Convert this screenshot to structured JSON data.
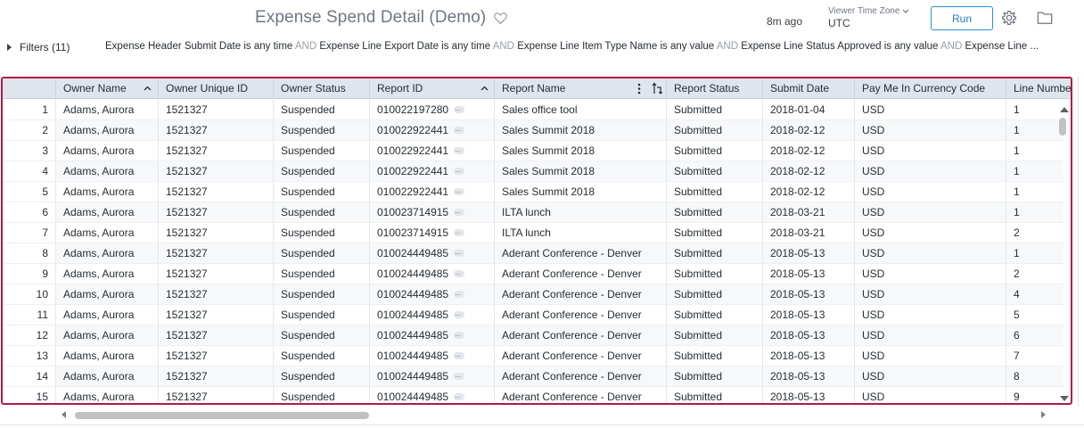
{
  "header": {
    "title": "Expense Spend Detail (Demo)",
    "updated_ago": "8m ago",
    "timezone_label": "Viewer Time Zone",
    "timezone_value": "UTC",
    "run_label": "Run",
    "icons": [
      "heart-icon",
      "chevron-down-icon",
      "gear-icon",
      "folder-icon"
    ]
  },
  "filters": {
    "label": "Filters (11)",
    "clauses": [
      {
        "field": "Expense Header Submit Date",
        "cond": "is any time"
      },
      {
        "field": "Expense Line Export Date",
        "cond": "is any time"
      },
      {
        "field": "Expense Line Item Type Name",
        "cond": "is any value"
      },
      {
        "field": "Expense Line Status Approved",
        "cond": "is any value"
      },
      {
        "field": "Expense Line ...",
        "cond": ""
      }
    ],
    "joiner": "AND"
  },
  "table": {
    "columns": [
      "",
      "Owner Name",
      "Owner Unique ID",
      "Owner Status",
      "Report ID",
      "Report Name",
      "Report Status",
      "Submit Date",
      "Pay Me In Currency Code",
      "Line Numbe"
    ],
    "rows": [
      [
        "1",
        "Adams, Aurora",
        "1521327",
        "Suspended",
        "010022197280",
        "Sales office tool",
        "Submitted",
        "2018-01-04",
        "USD",
        "1"
      ],
      [
        "2",
        "Adams, Aurora",
        "1521327",
        "Suspended",
        "010022922441",
        "Sales Summit 2018",
        "Submitted",
        "2018-02-12",
        "USD",
        "1"
      ],
      [
        "3",
        "Adams, Aurora",
        "1521327",
        "Suspended",
        "010022922441",
        "Sales Summit 2018",
        "Submitted",
        "2018-02-12",
        "USD",
        "1"
      ],
      [
        "4",
        "Adams, Aurora",
        "1521327",
        "Suspended",
        "010022922441",
        "Sales Summit 2018",
        "Submitted",
        "2018-02-12",
        "USD",
        "1"
      ],
      [
        "5",
        "Adams, Aurora",
        "1521327",
        "Suspended",
        "010022922441",
        "Sales Summit 2018",
        "Submitted",
        "2018-02-12",
        "USD",
        "1"
      ],
      [
        "6",
        "Adams, Aurora",
        "1521327",
        "Suspended",
        "010023714915",
        "ILTA lunch",
        "Submitted",
        "2018-03-21",
        "USD",
        "1"
      ],
      [
        "7",
        "Adams, Aurora",
        "1521327",
        "Suspended",
        "010023714915",
        "ILTA lunch",
        "Submitted",
        "2018-03-21",
        "USD",
        "2"
      ],
      [
        "8",
        "Adams, Aurora",
        "1521327",
        "Suspended",
        "010024449485",
        "Aderant Conference - Denver",
        "Submitted",
        "2018-05-13",
        "USD",
        "1"
      ],
      [
        "9",
        "Adams, Aurora",
        "1521327",
        "Suspended",
        "010024449485",
        "Aderant Conference - Denver",
        "Submitted",
        "2018-05-13",
        "USD",
        "2"
      ],
      [
        "10",
        "Adams, Aurora",
        "1521327",
        "Suspended",
        "010024449485",
        "Aderant Conference - Denver",
        "Submitted",
        "2018-05-13",
        "USD",
        "4"
      ],
      [
        "11",
        "Adams, Aurora",
        "1521327",
        "Suspended",
        "010024449485",
        "Aderant Conference - Denver",
        "Submitted",
        "2018-05-13",
        "USD",
        "5"
      ],
      [
        "12",
        "Adams, Aurora",
        "1521327",
        "Suspended",
        "010024449485",
        "Aderant Conference - Denver",
        "Submitted",
        "2018-05-13",
        "USD",
        "6"
      ],
      [
        "13",
        "Adams, Aurora",
        "1521327",
        "Suspended",
        "010024449485",
        "Aderant Conference - Denver",
        "Submitted",
        "2018-05-13",
        "USD",
        "7"
      ],
      [
        "14",
        "Adams, Aurora",
        "1521327",
        "Suspended",
        "010024449485",
        "Aderant Conference - Denver",
        "Submitted",
        "2018-05-13",
        "USD",
        "8"
      ],
      [
        "15",
        "Adams, Aurora",
        "1521327",
        "Suspended",
        "010024449485",
        "Aderant Conference - Denver",
        "Submitted",
        "2018-05-13",
        "USD",
        "9"
      ]
    ]
  },
  "colors": {
    "accent": "#2b8fd6",
    "frame": "#b11a46",
    "header_bg": "#dfe5ec"
  }
}
